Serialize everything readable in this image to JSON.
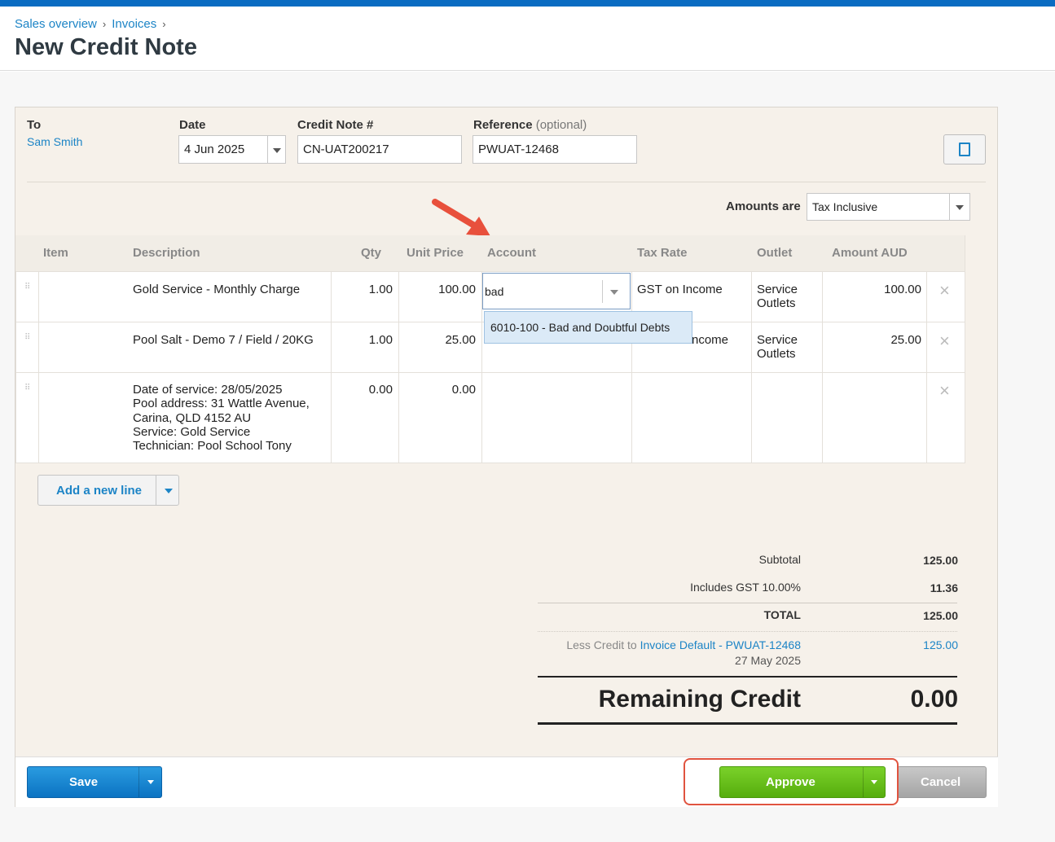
{
  "breadcrumb": {
    "items": [
      "Sales overview",
      "Invoices"
    ],
    "separator": "›"
  },
  "page_title": "New Credit Note",
  "form": {
    "to_label": "To",
    "to_value": "Sam Smith",
    "date_label": "Date",
    "date_value": "4 Jun 2025",
    "number_label": "Credit Note #",
    "number_value": "CN-UAT200217",
    "reference_label": "Reference",
    "reference_optional": "(optional)",
    "reference_value": "PWUAT-12468",
    "amounts_label": "Amounts are",
    "amounts_value": "Tax Inclusive"
  },
  "grid": {
    "headers": [
      "Item",
      "Description",
      "Qty",
      "Unit Price",
      "Account",
      "Tax Rate",
      "Outlet",
      "Amount AUD"
    ],
    "rows": [
      {
        "item": "",
        "description": [
          "Gold Service - Monthly Charge"
        ],
        "qty": "1.00",
        "unit_price": "100.00",
        "account": "bad",
        "tax_rate": "GST on Income",
        "outlet": [
          "Service",
          "Outlets"
        ],
        "amount": "100.00"
      },
      {
        "item": "",
        "description": [
          "Pool Salt - Demo 7 / Field / 20KG"
        ],
        "qty": "1.00",
        "unit_price": "25.00",
        "account": "",
        "tax_rate": "ncome",
        "outlet": [
          "Service",
          "Outlets"
        ],
        "amount": "25.00"
      },
      {
        "item": "",
        "description": [
          "Date of service: 28/05/2025",
          "Pool address: 31 Wattle Avenue,",
          "Carina, QLD 4152 AU",
          "Service: Gold Service",
          "Technician: Pool School Tony"
        ],
        "qty": "0.00",
        "unit_price": "0.00",
        "account": "",
        "tax_rate": "",
        "outlet": [
          "",
          ""
        ],
        "amount": ""
      }
    ],
    "autocomplete_option": "6010-100 - Bad and Doubtful Debts",
    "add_line_label": "Add a new line",
    "remove_icon": "×"
  },
  "totals": {
    "subtotal_label": "Subtotal",
    "subtotal_value": "125.00",
    "gst_label": "Includes GST 10.00%",
    "gst_value": "11.36",
    "total_label": "TOTAL",
    "total_value": "125.00",
    "less_credit_prefix": "Less Credit to",
    "less_credit_link": "Invoice Default - PWUAT-12468",
    "less_credit_date": "27 May 2025",
    "less_credit_value": "125.00",
    "remaining_label": "Remaining Credit",
    "remaining_value": "0.00"
  },
  "buttons": {
    "save": "Save",
    "approve": "Approve",
    "cancel": "Cancel"
  },
  "colors": {
    "top_bar": "#0a6cc2",
    "link": "#1c84c6",
    "approve": "#6cc11d",
    "save": "#1684d2",
    "highlight": "#e0533f"
  }
}
